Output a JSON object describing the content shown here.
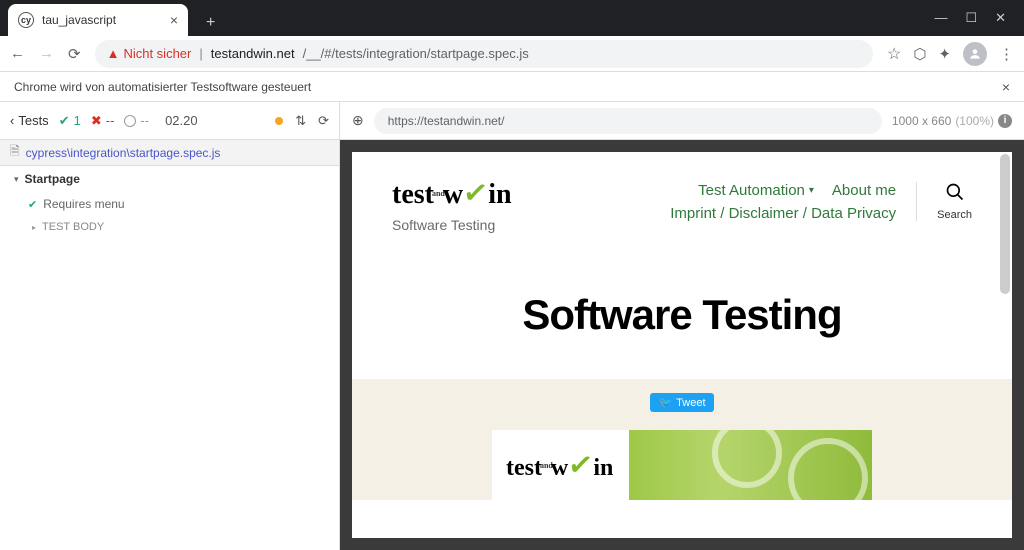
{
  "browser": {
    "tab_title": "tau_javascript",
    "not_secure_label": "Nicht sicher",
    "url_host": "testandwin.net",
    "url_path": "/__/#/tests/integration/startpage.spec.js",
    "infobar_text": "Chrome wird von automatisierter Testsoftware gesteuert"
  },
  "cypress": {
    "back_label": "Tests",
    "pass_count": "1",
    "fail_count": "--",
    "pending_count": "--",
    "duration": "02.20",
    "spec_file": "cypress\\integration\\startpage.spec.js",
    "suite_name": "Startpage",
    "test_name": "Requires menu",
    "test_body_label": "TEST BODY"
  },
  "aut": {
    "url": "https://testandwin.net/",
    "viewport_dims": "1000 x 660",
    "viewport_scale": "(100%)"
  },
  "site": {
    "logo_text_pre": "test",
    "logo_text_and": "and",
    "logo_text_post": "w",
    "logo_text_end": "in",
    "tagline": "Software Testing",
    "nav": {
      "test_automation": "Test Automation",
      "about_me": "About me",
      "privacy": "Imprint / Disclaimer / Data Privacy"
    },
    "search_label": "Search",
    "hero_title": "Software Testing",
    "tweet_label": "Tweet"
  }
}
